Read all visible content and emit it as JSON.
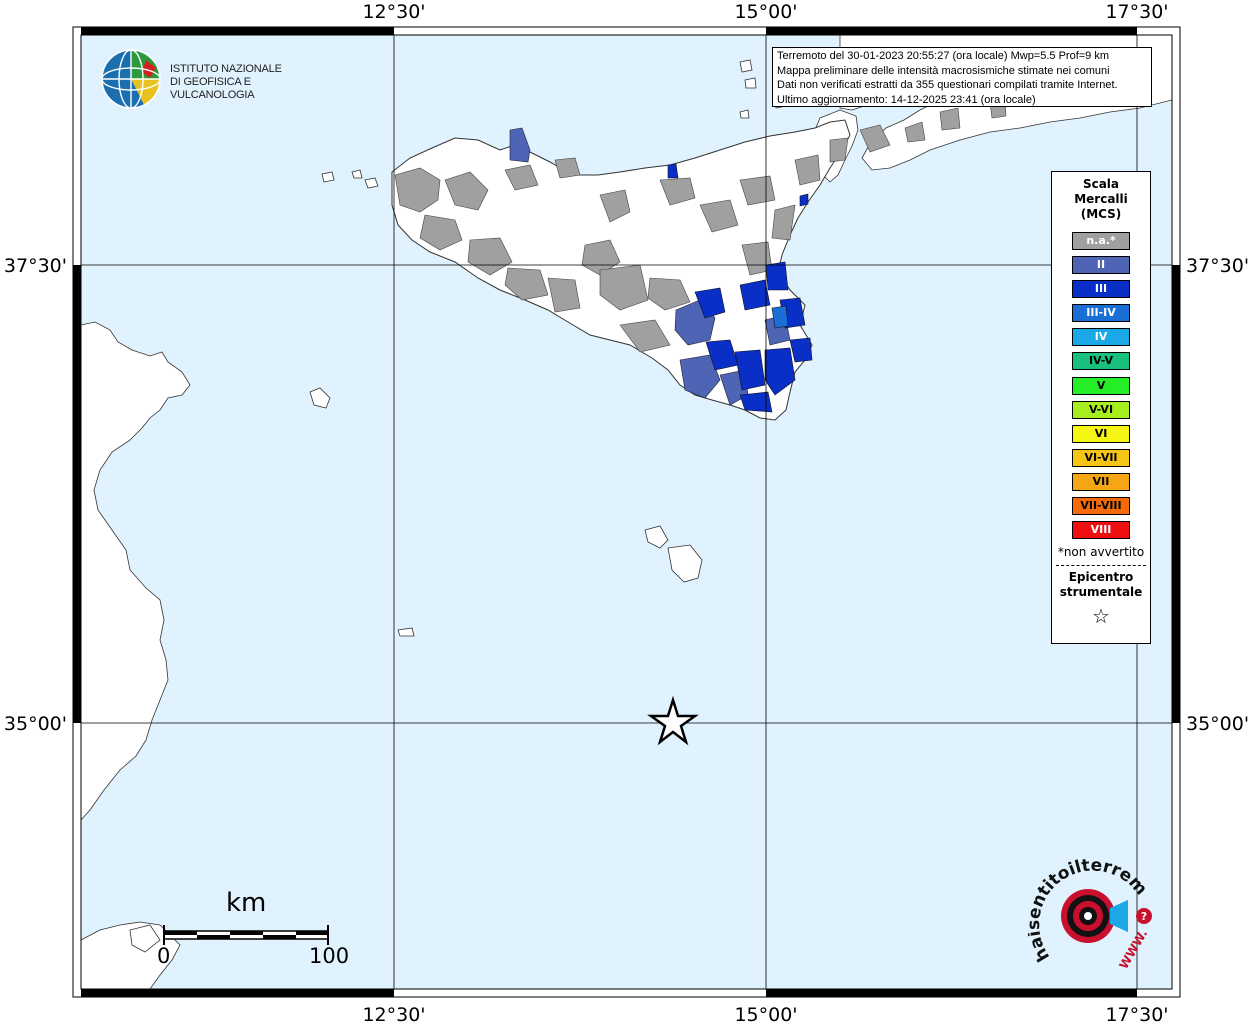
{
  "axes": {
    "top_labels": [
      "12°30'",
      "15°00'",
      "17°30'"
    ],
    "bottom_labels": [
      "12°30'",
      "15°00'",
      "17°30'"
    ],
    "left_labels": [
      "37°30'",
      "35°00'"
    ],
    "right_labels": [
      "37°30'",
      "35°00'"
    ]
  },
  "info": {
    "line1": "Terremoto del 30-01-2023 20:55:27 (ora locale) Mwp=5.5 Prof=9 km",
    "line2": "Mappa preliminare delle intensità macrosismiche stimate nei comuni",
    "line3": "Dati non verificati estratti da 355 questionari compilati tramite Internet.",
    "line4": "Ultimo aggiornamento: 14-12-2025 23:41 (ora locale)"
  },
  "logo": {
    "line1": "ISTITUTO NAZIONALE",
    "line2": "DI GEOFISICA E VULCANOLOGIA"
  },
  "legend": {
    "title_lines": [
      "Scala",
      "Mercalli",
      "(MCS)"
    ],
    "items": [
      {
        "label": "n.a.*",
        "color": "#a0a0a0",
        "text_color": "#ffffff"
      },
      {
        "label": "II",
        "color": "#4e64b4",
        "text_color": "#ffffff"
      },
      {
        "label": "III",
        "color": "#0a2fc6",
        "text_color": "#ffffff"
      },
      {
        "label": "III-IV",
        "color": "#1a6fd6",
        "text_color": "#ffffff"
      },
      {
        "label": "IV",
        "color": "#1aa8e6",
        "text_color": "#ffffff"
      },
      {
        "label": "IV-V",
        "color": "#18c07c",
        "text_color": "#000000"
      },
      {
        "label": "V",
        "color": "#26ee26",
        "text_color": "#000000"
      },
      {
        "label": "V-VI",
        "color": "#a6ee1e",
        "text_color": "#000000"
      },
      {
        "label": "VI",
        "color": "#f6f614",
        "text_color": "#000000"
      },
      {
        "label": "VI-VII",
        "color": "#f6c414",
        "text_color": "#000000"
      },
      {
        "label": "VII",
        "color": "#f6a614",
        "text_color": "#000000"
      },
      {
        "label": "VII-VIII",
        "color": "#f66a0a",
        "text_color": "#000000"
      },
      {
        "label": "VIII",
        "color": "#ee1010",
        "text_color": "#ffffff"
      }
    ],
    "note": "*non avvertito",
    "epicentre_lines": [
      "Epicentro",
      "strumentale"
    ],
    "star": "☆"
  },
  "scalebar": {
    "title": "km",
    "start": "0",
    "end": "100"
  },
  "watermark": {
    "text": "haisentitoilterremoto.it",
    "url": "WWW."
  },
  "colors": {
    "sea": "#dff2fd",
    "land": "#ffffff",
    "gray": "#a0a0a0",
    "blue2": "#4e64b4",
    "blue3": "#0a2fc6",
    "blue34": "#1a6fd6"
  }
}
